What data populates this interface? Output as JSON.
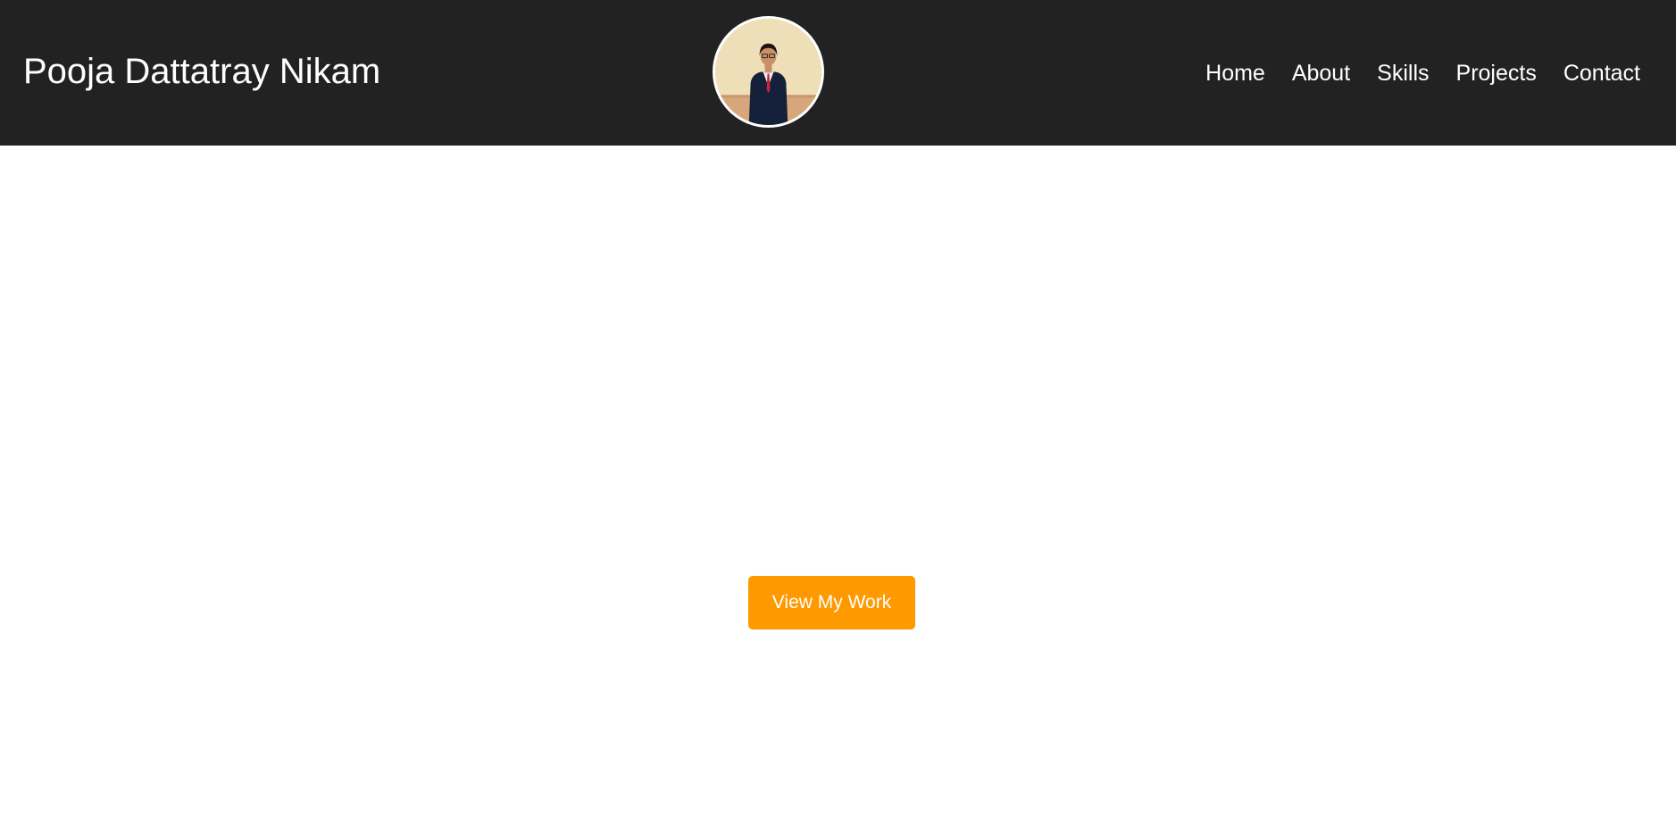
{
  "header": {
    "title": "Pooja Dattatray Nikam",
    "avatar_alt": "profile photo",
    "nav": [
      {
        "label": "Home"
      },
      {
        "label": "About"
      },
      {
        "label": "Skills"
      },
      {
        "label": "Projects"
      },
      {
        "label": "Contact"
      }
    ]
  },
  "hero": {
    "cta_label": "View My Work"
  },
  "colors": {
    "header_bg": "#222222",
    "accent": "#ff9900",
    "page_bg": "#ffffff"
  }
}
